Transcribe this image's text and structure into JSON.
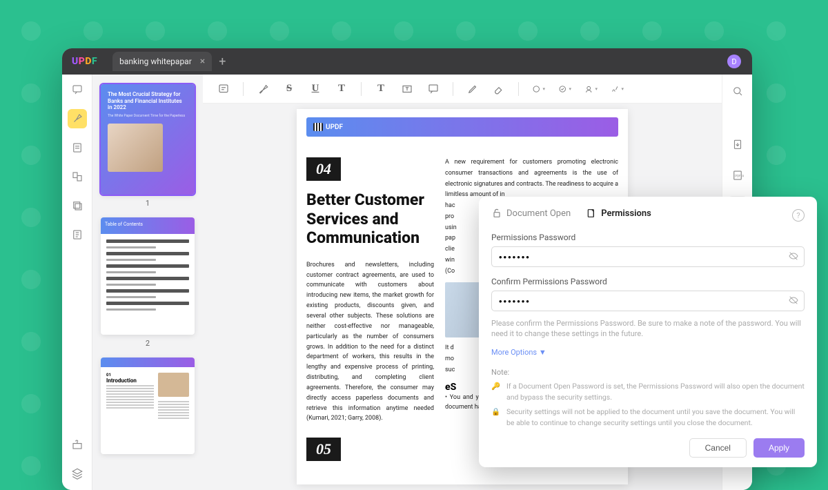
{
  "app": {
    "logo": "UPDF"
  },
  "tab": {
    "name": "banking whitepapar"
  },
  "avatar": {
    "initial": "D"
  },
  "thumbs": {
    "t1": {
      "title": "The Most Crucial Strategy for Banks and Financial Institutes in 2022",
      "sub": "The White Paper Document Time for the Paperless",
      "num": "1"
    },
    "t2": {
      "title": "Table of Contents",
      "num": "2"
    },
    "t3": {
      "num01": "01",
      "title": "Introduction"
    }
  },
  "page": {
    "logoText": "UPDF",
    "num04": "04",
    "h1": "Better Customer Services and Communication",
    "p1": "Brochures and newsletters, including customer contract agreements, are used to communicate with customers about introducing new items, the market growth for existing products, discounts given, and several other subjects. These solutions are neither cost-effective nor manageable, particularly as the number of consumers grows. In addition to the need for a distinct department of workers, this results in the lengthy and expensive process of printing, distributing, and completing client agreements. Therefore, the consumer may directly access paperless documents and retrieve this information anytime needed (Kumari, 2021; Garry, 2008).",
    "p2a": "A new requirement for customers promoting electronic consumer transactions and agreements is the use of electronic signatures and contracts. The readiness to acquire a limitless amount of in",
    "p2b": "hac",
    "p2c": "pro",
    "p2d": "usin",
    "p2e": "pap",
    "p2f": "clie",
    "p2g": "win",
    "p2h": "(Co",
    "p3": "It d",
    "p4": "mo",
    "p5": "suc",
    "h2": "eS",
    "bullet": "• You and your concerned customer will get notified when a document has been signed electronically",
    "num05": "05"
  },
  "dialog": {
    "tab1": "Document Open",
    "tab2": "Permissions",
    "passLabel": "Permissions Password",
    "passValue": "•••••••",
    "confirmLabel": "Confirm Permissions Password",
    "confirmValue": "•••••••",
    "hint": "Please confirm the Permissions Password. Be sure to make a note of the password. You will need it to change these settings in the future.",
    "moreOptions": "More Options  ▼",
    "noteTitle": "Note:",
    "note1": "If a Document Open Password is set, the Permissions Password will also open the document and bypass the security settings.",
    "note2": "Security settings will not be applied to the document until you save the document. You will be able to continue to change security settings until you close the document.",
    "cancel": "Cancel",
    "apply": "Apply"
  }
}
